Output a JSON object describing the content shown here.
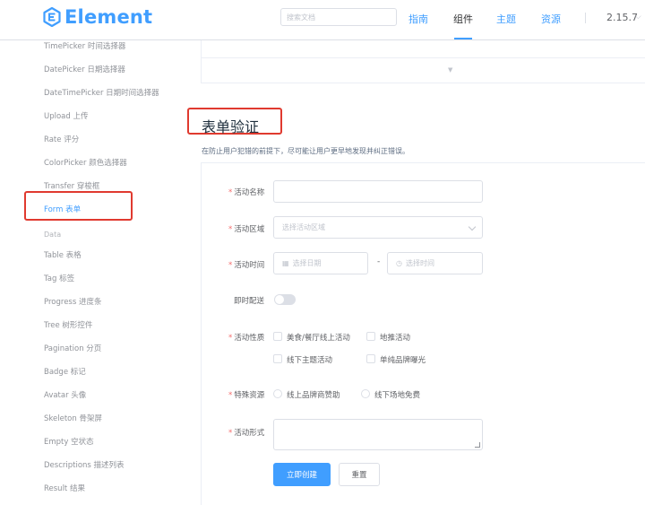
{
  "header": {
    "logo_text": "Element",
    "search_placeholder": "搜索文档",
    "nav": [
      "指南",
      "组件",
      "主题",
      "资源"
    ],
    "active_nav": "组件",
    "version": "2.15.7",
    "accent_color": "#409eff"
  },
  "sidebar": {
    "items": [
      "TimePicker 时间选择器",
      "DatePicker 日期选择器",
      "DateTimePicker 日期时间选择器",
      "Upload 上传",
      "Rate 评分",
      "ColorPicker 颜色选择器",
      "Transfer 穿梭框",
      "Form 表单"
    ],
    "active_item": "Form 表单",
    "group_label": "Data",
    "data_items": [
      "Table 表格",
      "Tag 标签",
      "Progress 进度条",
      "Tree 树形控件",
      "Pagination 分页",
      "Badge 标记",
      "Avatar 头像",
      "Skeleton 骨架屏",
      "Empty 空状态",
      "Descriptions 描述列表",
      "Result 结果"
    ]
  },
  "section": {
    "title": "表单验证",
    "description": "在防止用户犯错的前提下，尽可能让用户更早地发现并纠正错误。"
  },
  "form": {
    "required_mark": "*",
    "name_label": "活动名称",
    "name_value": "",
    "region_label": "活动区域",
    "region_placeholder": "选择活动区域",
    "time_label": "活动时间",
    "date_placeholder": "选择日期",
    "time_placeholder": "选择时间",
    "range_separator": "-",
    "delivery_label": "即时配送",
    "nature_label": "活动性质",
    "nature_options": [
      "美食/餐厅线上活动",
      "地推活动",
      "线下主题活动",
      "单纯品牌曝光"
    ],
    "resource_label": "特殊资源",
    "resource_options": [
      "线上品牌商赞助",
      "线下场地免费"
    ],
    "form_label": "活动形式",
    "submit_label": "立即创建",
    "reset_label": "重置"
  },
  "highlight_color": "#e03a2f"
}
